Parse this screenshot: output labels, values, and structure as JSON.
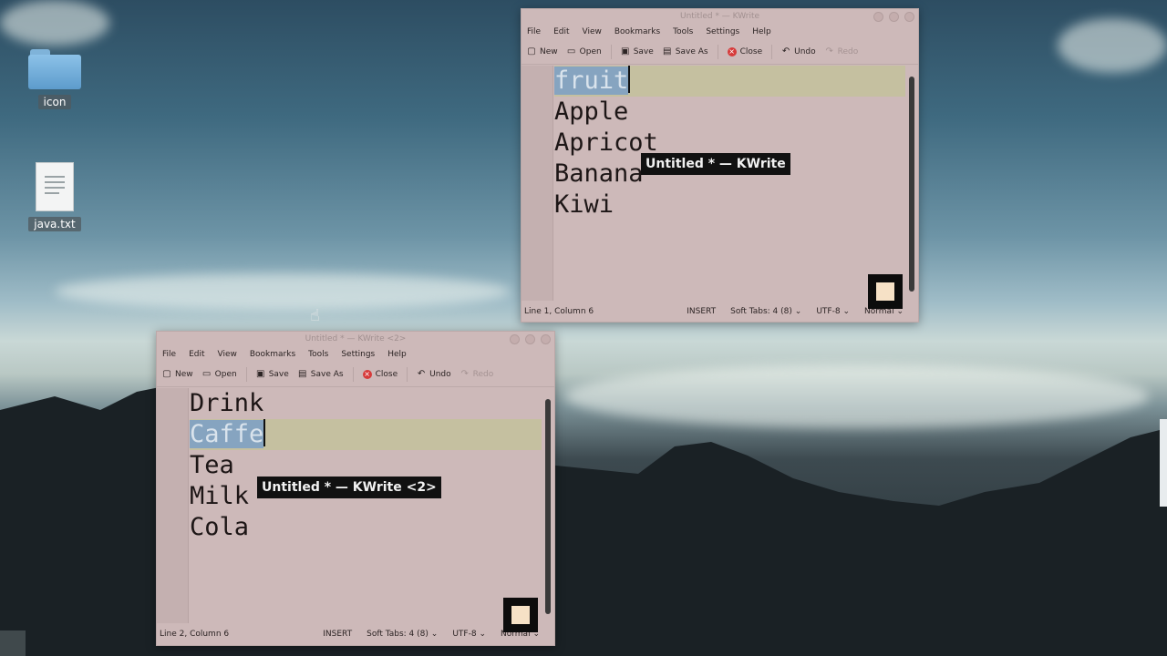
{
  "desktop": {
    "icons": [
      {
        "label": "icon",
        "icon": "folder-icon"
      },
      {
        "label": "java.txt",
        "icon": "text-file-icon"
      }
    ]
  },
  "window1": {
    "title": "Untitled * — KWrite",
    "menu": [
      "File",
      "Edit",
      "View",
      "Bookmarks",
      "Tools",
      "Settings",
      "Help"
    ],
    "toolbar": {
      "new": "New",
      "open": "Open",
      "save": "Save",
      "save_as": "Save As",
      "close": "Close",
      "undo": "Undo",
      "redo": "Redo"
    },
    "lines": [
      "Apple",
      "Apricot",
      "Banana",
      "Kiwi"
    ],
    "selected_line": "fruit",
    "status": {
      "position": "Line 1, Column 6",
      "mode": "INSERT",
      "tabs": "Soft Tabs: 4 (8)",
      "encoding": "UTF-8",
      "highlight": "Normal"
    },
    "tooltip": "Untitled * — KWrite"
  },
  "window2": {
    "title": "Untitled * — KWrite <2>",
    "menu": [
      "File",
      "Edit",
      "View",
      "Bookmarks",
      "Tools",
      "Settings",
      "Help"
    ],
    "toolbar": {
      "new": "New",
      "open": "Open",
      "save": "Save",
      "save_as": "Save As",
      "close": "Close",
      "undo": "Undo",
      "redo": "Redo"
    },
    "first_line": "Drink",
    "selected_line": "Caffe",
    "lines": [
      "Tea",
      "Milk",
      "Cola"
    ],
    "status": {
      "position": "Line 2, Column 6",
      "mode": "INSERT",
      "tabs": "Soft Tabs: 4 (8)",
      "encoding": "UTF-8",
      "highlight": "Normal"
    },
    "tooltip": "Untitled * — KWrite <2>"
  },
  "colors": {
    "selection": "#86a4c0",
    "current_line": "#c5c0a0",
    "window_bg": "#cdb9b9",
    "close_red": "#d63a3a"
  }
}
